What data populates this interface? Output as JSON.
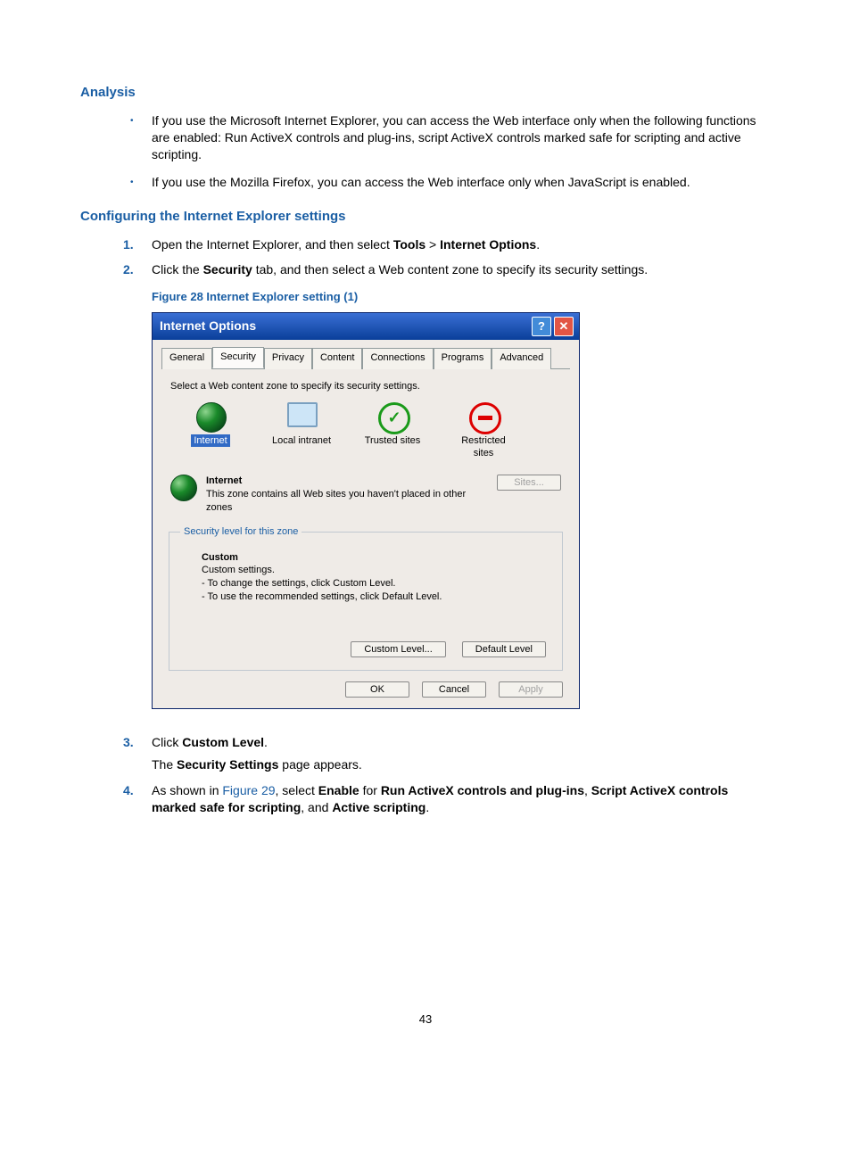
{
  "headings": {
    "analysis": "Analysis",
    "configuring": "Configuring the Internet Explorer settings"
  },
  "bullets": [
    "If you use the Microsoft Internet Explorer, you can access the Web interface only when the following functions are enabled: Run ActiveX controls and plug-ins, script ActiveX controls marked safe for scripting and active scripting.",
    "If you use the Mozilla Firefox, you can access the Web interface only when JavaScript is enabled."
  ],
  "steps": {
    "s1_pre": "Open the Internet Explorer, and then select ",
    "s1_b1": "Tools",
    "s1_gt": " > ",
    "s1_b2": "Internet Options",
    "s1_post": ".",
    "s2_pre": "Click the ",
    "s2_b1": "Security",
    "s2_post": " tab, and then select a Web content zone to specify its security settings.",
    "s3_pre": "Click ",
    "s3_b1": "Custom Level",
    "s3_post": ".",
    "s3_sub_pre": "The ",
    "s3_sub_b": "Security Settings",
    "s3_sub_post": " page appears.",
    "s4_pre": "As shown in ",
    "s4_link": "Figure 29",
    "s4_mid1": ", select ",
    "s4_b1": "Enable",
    "s4_mid2": " for ",
    "s4_b2": "Run ActiveX controls and plug-ins",
    "s4_c1": ", ",
    "s4_b3": "Script ActiveX controls marked safe for scripting",
    "s4_c2": ", and ",
    "s4_b4": "Active scripting",
    "s4_post": "."
  },
  "figure_caption": "Figure 28 Internet Explorer setting (1)",
  "dialog": {
    "title": "Internet Options",
    "help_glyph": "?",
    "close_glyph": "✕",
    "tabs": [
      "General",
      "Security",
      "Privacy",
      "Content",
      "Connections",
      "Programs",
      "Advanced"
    ],
    "active_tab_index": 1,
    "zone_instruction": "Select a Web content zone to specify its security settings.",
    "zones": [
      {
        "label": "Internet",
        "selected": true
      },
      {
        "label": "Local intranet",
        "selected": false
      },
      {
        "label": "Trusted sites",
        "selected": false
      },
      {
        "label": "Restricted sites",
        "selected": false
      }
    ],
    "zone_info_title": "Internet",
    "zone_info_desc": "This zone contains all Web sites you haven't placed in other zones",
    "sites_button": "Sites...",
    "sec_legend": "Security level for this zone",
    "custom_title": "Custom",
    "custom_lines": [
      "Custom settings.",
      "- To change the settings, click Custom Level.",
      "- To use the recommended settings, click Default Level."
    ],
    "custom_level_btn": "Custom Level...",
    "default_level_btn": "Default Level",
    "ok_btn": "OK",
    "cancel_btn": "Cancel",
    "apply_btn": "Apply"
  },
  "page_number": "43"
}
